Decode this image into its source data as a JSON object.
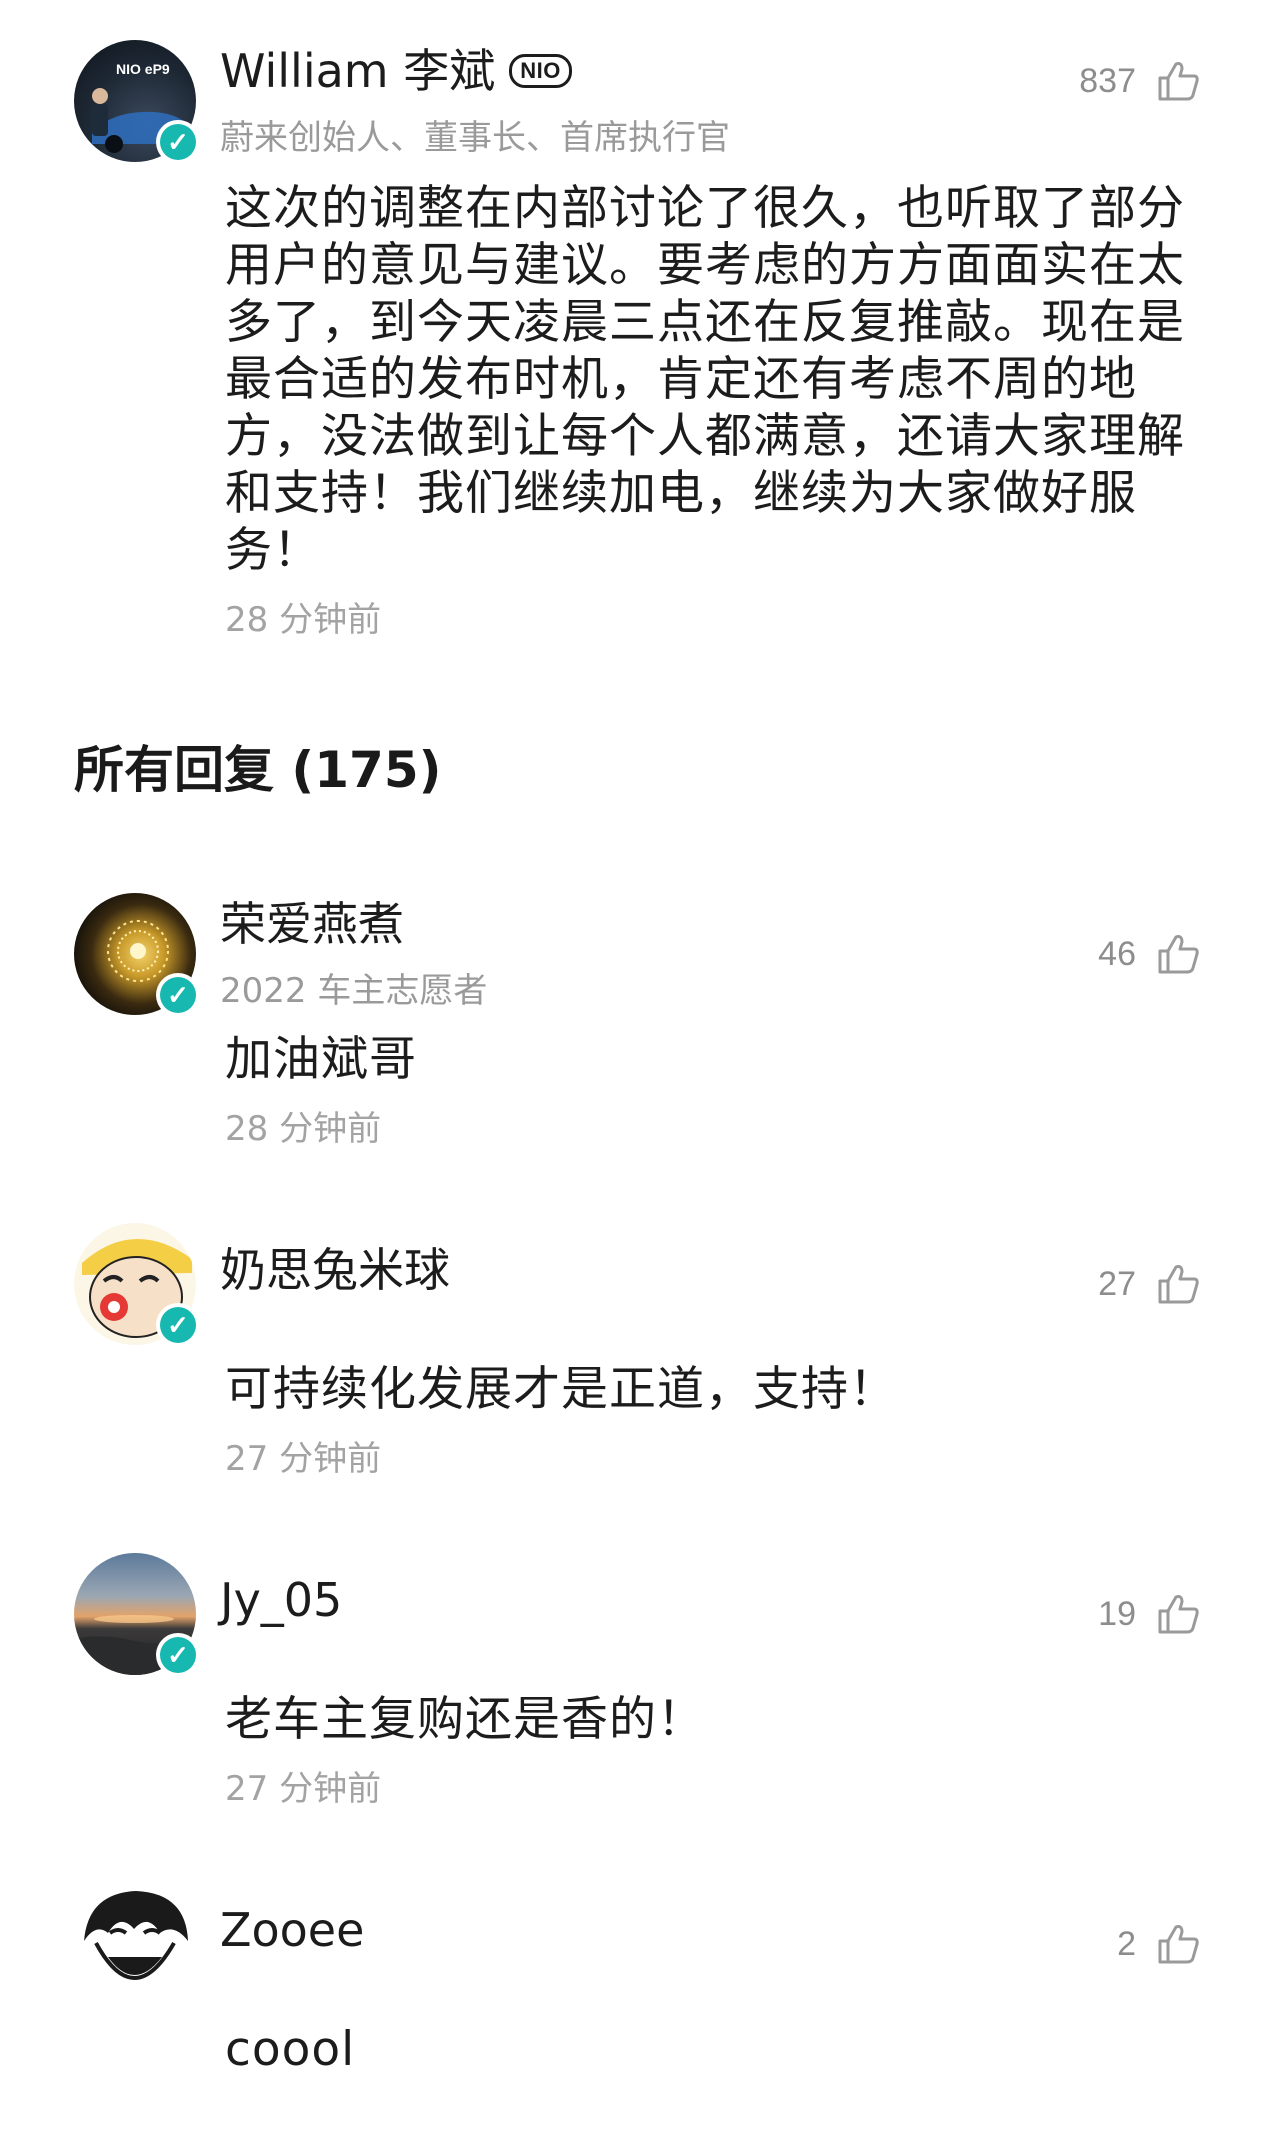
{
  "main_post": {
    "username": "William 李斌",
    "badge": "NIO",
    "subtitle": "蔚来创始人、董事长、首席执行官",
    "likes": "837",
    "text": "这次的调整在内部讨论了很久，也听取了部分用户的意见与建议。要考虑的方方面面实在太多了，到今天凌晨三点还在反复推敲。现在是最合适的发布时机，肯定还有考虑不周的地方，没法做到让每个人都满意，还请大家理解和支持！我们继续加电，继续为大家做好服务！",
    "time": "28 分钟前",
    "avatar_logo": "NIO eP9"
  },
  "replies_header": "所有回复 (175)",
  "replies": [
    {
      "username": "荣爱燕煮",
      "subtitle": "2022 车主志愿者",
      "likes": "46",
      "text": "加油斌哥",
      "time": "28 分钟前"
    },
    {
      "username": "奶思兔米球",
      "likes": "27",
      "text": "可持续化发展才是正道，支持！",
      "time": "27 分钟前"
    },
    {
      "username": "Jy_05",
      "likes": "19",
      "text": "老车主复购还是香的！",
      "time": "27 分钟前"
    },
    {
      "username": "Zooee",
      "likes": "2",
      "text": "coool"
    }
  ],
  "colors": {
    "verified": "#16b8b0",
    "meta_gray": "#9a9a9a",
    "text": "#1c1c1c"
  },
  "icons": {
    "like": "thumbs-up-icon",
    "verified": "verified-v-icon"
  }
}
